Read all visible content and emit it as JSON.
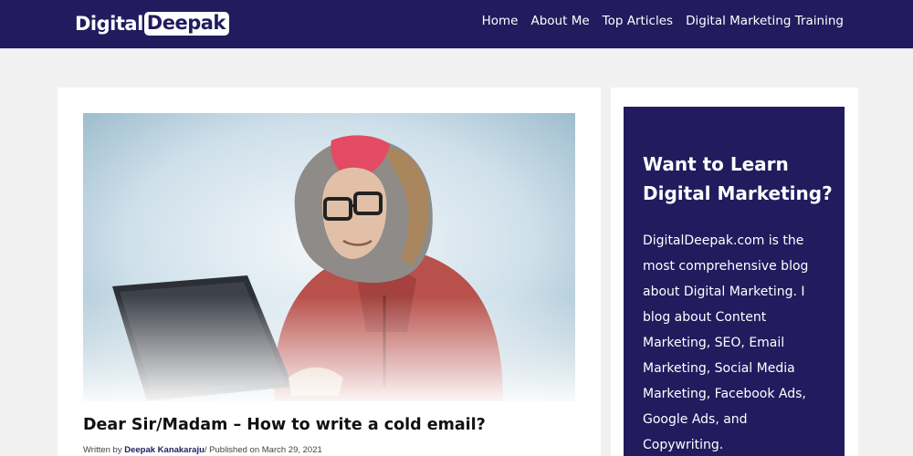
{
  "header": {
    "logo_part1": "Digital",
    "logo_part2": "Deepak",
    "nav": [
      "Home",
      "About Me",
      "Top Articles",
      "Digital Marketing Training"
    ]
  },
  "post": {
    "image_icon": "hero-image-man-in-winter-hat-with-laptop",
    "title": "Dear Sir/Madam – How to write a cold email?",
    "byline_prefix": "Written by ",
    "author": "Deepak Kanakaraju",
    "byline_suffix": "/ Published on March 29, 2021"
  },
  "sidebar": {
    "title": "Want to Learn Digital Marketing?",
    "text": "DigitalDeepak.com is the most comprehensive blog about Digital Marketing. I blog about Content Marketing, SEO, Email Marketing, Social Media Marketing, Facebook Ads, Google Ads, and Copywriting."
  },
  "colors": {
    "brand_navy": "#221b5e",
    "page_bg": "#f1f1f1"
  }
}
